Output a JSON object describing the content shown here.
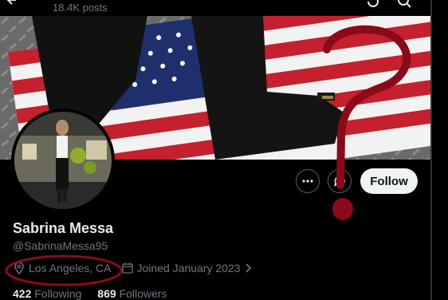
{
  "header": {
    "posts_count": "18.4K posts"
  },
  "profile": {
    "name": "Sabrina Messa",
    "handle": "@SabrinaMessa95",
    "location": "Los Angeles, CA",
    "joined": "Joined January 2023",
    "following_count": "422",
    "following_label": "Following",
    "followers_count": "869",
    "followers_label": "Followers"
  },
  "actions": {
    "follow_label": "Follow"
  },
  "colors": {
    "annotation": "#8b0a1a",
    "follow_bg": "#eff3f4",
    "muted_text": "#71767b"
  },
  "icons": [
    "back-arrow-icon",
    "refresh-icon",
    "search-icon",
    "more-icon",
    "message-icon",
    "location-pin-icon",
    "calendar-icon",
    "chevron-right-icon"
  ]
}
